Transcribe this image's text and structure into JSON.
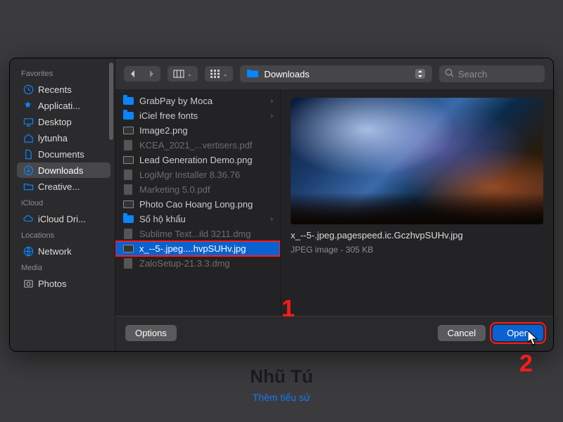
{
  "background": {
    "name": "Nhũ Tú",
    "subtitle": "Thêm tiểu sử"
  },
  "sidebar": {
    "sections": {
      "favorites": "Favorites",
      "icloud": "iCloud",
      "locations": "Locations",
      "media": "Media"
    },
    "items": {
      "recents": "Recents",
      "applications": "Applicati...",
      "desktop": "Desktop",
      "lytunha": "lytunha",
      "documents": "Documents",
      "downloads": "Downloads",
      "creative": "Creative...",
      "icloud_drive": "iCloud Dri...",
      "network": "Network",
      "photos": "Photos"
    }
  },
  "toolbar": {
    "location": "Downloads",
    "search_placeholder": "Search"
  },
  "files": [
    {
      "name": "GrabPay by Moca",
      "type": "folder",
      "dim": false,
      "arrow": true
    },
    {
      "name": "iCiel free fonts",
      "type": "folder",
      "dim": false,
      "arrow": true
    },
    {
      "name": "Image2.png",
      "type": "img",
      "dim": false
    },
    {
      "name": "KCEA_2021_...vertisers.pdf",
      "type": "doc",
      "dim": true
    },
    {
      "name": "Lead Generation Demo.png",
      "type": "img",
      "dim": false
    },
    {
      "name": "LogiMgr Installer 8.36.76",
      "type": "doc",
      "dim": true
    },
    {
      "name": "Marketing 5.0.pdf",
      "type": "doc",
      "dim": true
    },
    {
      "name": "Photo Cao Hoang Long.png",
      "type": "img",
      "dim": false
    },
    {
      "name": "Sổ hộ khẩu",
      "type": "folder",
      "dim": false,
      "arrow": true
    },
    {
      "name": "Sublime Text...ild 3211.dmg",
      "type": "doc",
      "dim": true
    },
    {
      "name": "x_--5-.jpeg....hvpSUHv.jpg",
      "type": "img",
      "dim": false,
      "selected": true
    },
    {
      "name": "ZaloSetup-21.3.3.dmg",
      "type": "doc",
      "dim": true
    }
  ],
  "preview": {
    "filename": "x_--5-.jpeg.pagespeed.ic.GczhvpSUHv.jpg",
    "meta": "JPEG image - 305 KB"
  },
  "footer": {
    "options": "Options",
    "cancel": "Cancel",
    "open": "Open"
  },
  "annotations": {
    "one": "1",
    "two": "2"
  }
}
